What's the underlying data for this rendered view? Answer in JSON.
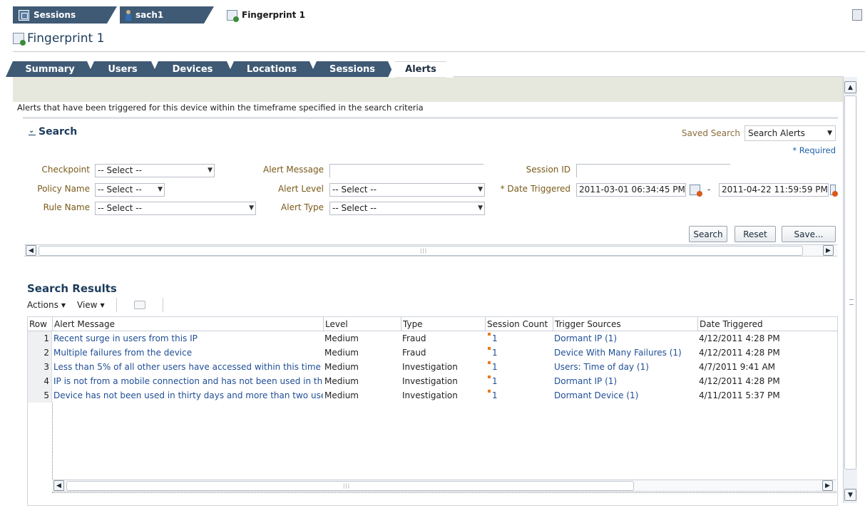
{
  "doc_tabs": [
    {
      "label": "Sessions",
      "icon": "sessions-icon"
    },
    {
      "label": "sach1",
      "icon": "user-icon"
    },
    {
      "label": "Fingerprint 1",
      "icon": "fingerprint-icon"
    }
  ],
  "page": {
    "title": "Fingerprint 1"
  },
  "sub_tabs": [
    "Summary",
    "Users",
    "Devices",
    "Locations",
    "Sessions",
    "Alerts"
  ],
  "active_sub_tab": "Alerts",
  "description": "Alerts that have been triggered for this device within the timeframe specified in the search criteria",
  "search": {
    "title": "Search",
    "saved_search_label": "Saved Search",
    "saved_search_value": "Search Alerts",
    "required_note": "* Required",
    "fields": {
      "checkpoint_label": "Checkpoint",
      "checkpoint_value": "-- Select --",
      "policy_label": "Policy Name",
      "policy_value": "-- Select --",
      "rule_label": "Rule Name",
      "rule_value": "-- Select --",
      "alert_message_label": "Alert Message",
      "alert_level_label": "Alert Level",
      "alert_level_value": "-- Select --",
      "alert_type_label": "Alert Type",
      "alert_type_value": "-- Select --",
      "session_id_label": "Session ID",
      "date_label": "* Date Triggered",
      "date_from": "2011-03-01 06:34:45 PM",
      "date_to": "2011-04-22 11:59:59 PM",
      "date_sep": "-"
    },
    "buttons": {
      "search": "Search",
      "reset": "Reset",
      "save": "Save..."
    }
  },
  "results": {
    "title": "Search Results",
    "actions_label": "Actions",
    "view_label": "View",
    "columns": [
      "Row",
      "Alert Message",
      "Level",
      "Type",
      "Session Count",
      "Trigger Sources",
      "Date Triggered"
    ],
    "rows": [
      {
        "row": "1",
        "message": "Recent surge in users from this IP",
        "level": "Medium",
        "type": "Fraud",
        "count": "1",
        "trigger": "Dormant IP (1)",
        "date": "4/12/2011 4:28 PM"
      },
      {
        "row": "2",
        "message": "Multiple failures from the device",
        "level": "Medium",
        "type": "Fraud",
        "count": "1",
        "trigger": "Device With Many Failures (1)",
        "date": "4/12/2011 4:28 PM"
      },
      {
        "row": "3",
        "message": "Less than 5% of all other users have accessed within this time",
        "level": "Medium",
        "type": "Investigation",
        "count": "1",
        "trigger": "Users: Time of day (1)",
        "date": "4/7/2011 9:41 AM"
      },
      {
        "row": "4",
        "message": "IP is not from a mobile connection and has not been used in thi",
        "level": "Medium",
        "type": "Investigation",
        "count": "1",
        "trigger": "Dormant IP (1)",
        "date": "4/12/2011 4:28 PM"
      },
      {
        "row": "5",
        "message": "Device has not been used in thirty days and more than two use",
        "level": "Medium",
        "type": "Investigation",
        "count": "1",
        "trigger": "Dormant Device (1)",
        "date": "4/11/2011 5:37 PM"
      }
    ]
  },
  "colors": {
    "tab_dark": "#3f5a75",
    "link": "#1f4e96",
    "label": "#7a5a1a",
    "title": "#1d3c5c"
  }
}
